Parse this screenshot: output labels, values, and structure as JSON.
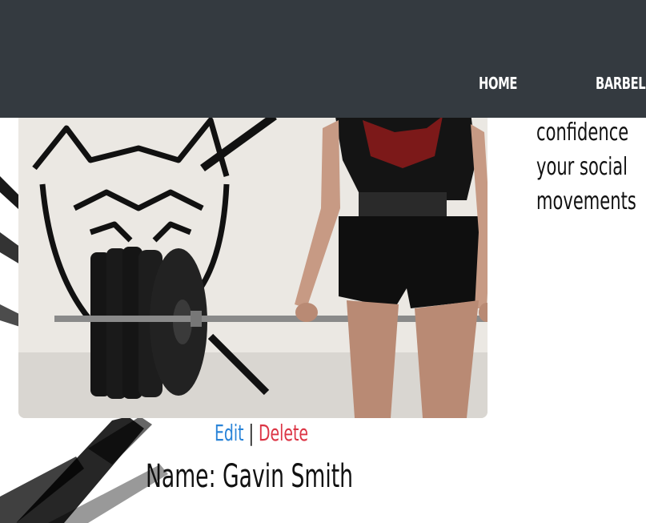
{
  "nav": {
    "items": [
      {
        "label": "HOME"
      },
      {
        "label": "BARBELL"
      }
    ]
  },
  "side_text": {
    "lines": [
      "confidence",
      "your social",
      "movements"
    ]
  },
  "actions": {
    "edit_label": "Edit",
    "separator": "|",
    "delete_label": "Delete"
  },
  "profile": {
    "name_label": "Name:",
    "name_value": "Gavin Smith"
  },
  "colors": {
    "navbar": "#343a40",
    "edit_link": "#2a84d8",
    "delete_link": "#dc3545"
  }
}
